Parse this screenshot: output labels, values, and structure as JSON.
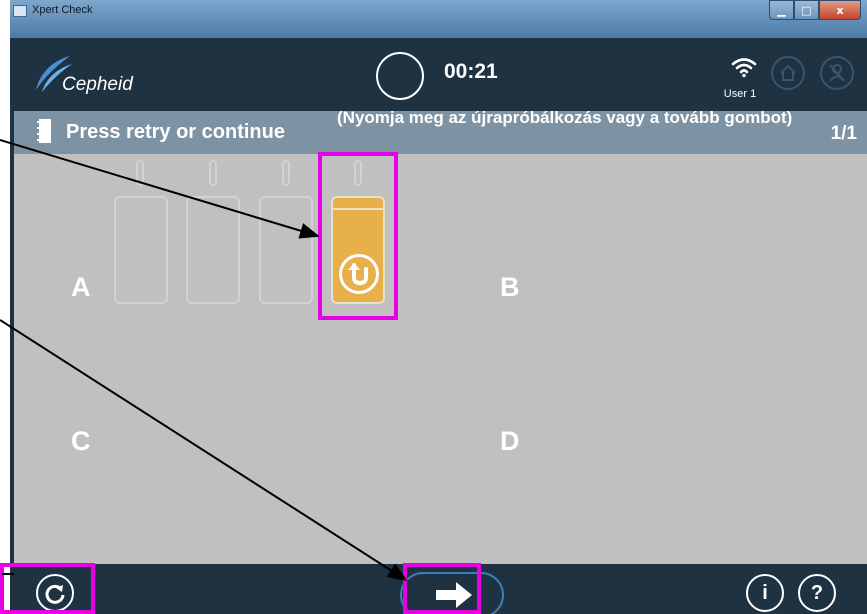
{
  "window": {
    "title": "Xpert Check",
    "controls": {
      "minimize": "▁",
      "maximize": "□",
      "close": "x"
    }
  },
  "header": {
    "brand": "Cepheid",
    "timer": "00:21",
    "user": "User 1",
    "icons": [
      "wifi-icon",
      "home-icon",
      "no-user-icon"
    ]
  },
  "status": {
    "instruction": "Press retry or continue",
    "page": "1/1"
  },
  "annotation": {
    "translation": "(Nyomja meg az újrapróbálkozás vagy a tovább gombot)",
    "highlight_color": "#e600e6"
  },
  "quadrants": {
    "a": "A",
    "b": "B",
    "c": "C",
    "d": "D"
  },
  "modules": {
    "count": 4,
    "active_index": 4,
    "active_color": "#e8b04a",
    "active_icon": "retry-arrow-icon"
  },
  "footer": {
    "retry_icon": "retry-icon",
    "continue_icon": "arrow-right-icon",
    "info_label": "i",
    "help_label": "?"
  },
  "colors": {
    "header_bg": "#1f3242",
    "status_bg": "#7d92a3",
    "main_bg": "#c0c0c0"
  }
}
